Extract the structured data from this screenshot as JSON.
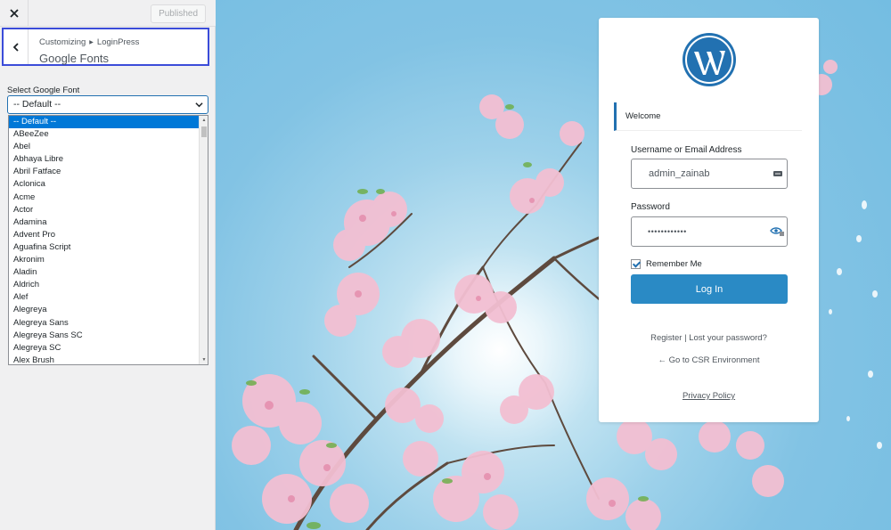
{
  "sidebar": {
    "close_icon": "close-icon",
    "published_label": "Published",
    "breadcrumb": {
      "parent1": "Customizing",
      "parent2": "LoginPress"
    },
    "section_title": "Google Fonts",
    "font_select": {
      "label": "Select Google Font",
      "selected_value": "-- Default --",
      "options": [
        "-- Default --",
        "ABeeZee",
        "Abel",
        "Abhaya Libre",
        "Abril Fatface",
        "Aclonica",
        "Acme",
        "Actor",
        "Adamina",
        "Advent Pro",
        "Aguafina Script",
        "Akronim",
        "Aladin",
        "Aldrich",
        "Alef",
        "Alegreya",
        "Alegreya Sans",
        "Alegreya Sans SC",
        "Alegreya SC",
        "Alex Brush"
      ]
    }
  },
  "login": {
    "welcome": "Welcome",
    "username_label": "Username or Email Address",
    "username_value": "admin_zainab",
    "password_label": "Password",
    "password_value": "••••••••••••",
    "remember_label": "Remember Me",
    "remember_checked": true,
    "login_button": "Log In",
    "register_link": "Register",
    "links_separator": "|",
    "lost_password_link": "Lost your password?",
    "back_link": "← Go to CSR Environment",
    "privacy_link": "Privacy Policy"
  },
  "colors": {
    "accent": "#2271b1",
    "button": "#2a8ac5",
    "highlight_border": "#3b4cd9",
    "selected_option": "#0078d7",
    "sky": "#82c3e4",
    "blossom": "#f3bfd2"
  }
}
